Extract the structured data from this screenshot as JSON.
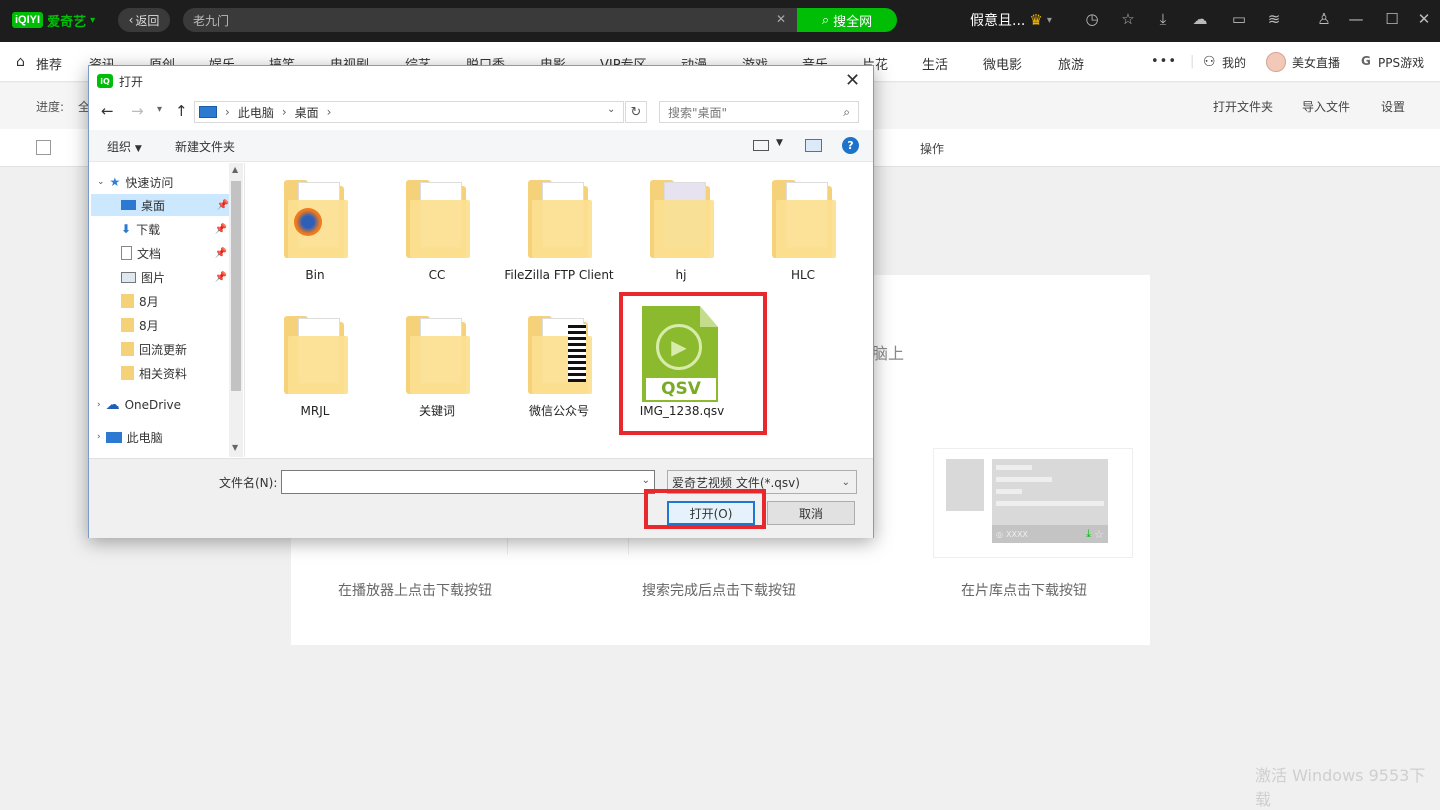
{
  "app": {
    "logo_box": "iQIYI",
    "logo_text": "爱奇艺",
    "back_label": "返回",
    "search_value": "老九门",
    "search_button": "搜全网",
    "user_name": "假意且..."
  },
  "nav": {
    "items": [
      "推荐",
      "资讯",
      "原创",
      "娱乐",
      "搞笑",
      "电视剧",
      "综艺",
      "脱口秀",
      "电影",
      "VIP专区",
      "动漫",
      "游戏",
      "音乐",
      "片花",
      "生活",
      "微电影",
      "旅游"
    ],
    "more": "•••",
    "right": [
      "我的",
      "美女直播",
      "PPS游戏"
    ]
  },
  "subbar": {
    "progress_label": "进度:",
    "progress_trunc": "全",
    "actions": [
      "打开文件夹",
      "导入文件",
      "设置"
    ]
  },
  "table_header": {
    "operation": "操作"
  },
  "card": {
    "steps": [
      "在播放器上点击下载按钮",
      "搜索完成后点击下载按钮",
      "在片库点击下载按钮"
    ],
    "partial_text": "脑上",
    "mock_text": "XXXX"
  },
  "dialog": {
    "title": "打开",
    "path": [
      "此电脑",
      "桌面"
    ],
    "search_placeholder": "搜索\"桌面\"",
    "organize": "组织",
    "new_folder": "新建文件夹",
    "tree": [
      {
        "label": "快速访问",
        "icon": "star-icon",
        "pin": false
      },
      {
        "label": "桌面",
        "icon": "desktop-icon",
        "pin": true,
        "selected": true
      },
      {
        "label": "下载",
        "icon": "download-icon",
        "pin": true
      },
      {
        "label": "文档",
        "icon": "document-icon",
        "pin": true
      },
      {
        "label": "图片",
        "icon": "picture-icon",
        "pin": true
      },
      {
        "label": "8月",
        "icon": "folder-icon",
        "pin": false
      },
      {
        "label": "8月",
        "icon": "folder-icon",
        "pin": false
      },
      {
        "label": "回流更新",
        "icon": "folder-icon",
        "pin": false
      },
      {
        "label": "相关资料",
        "icon": "folder-icon",
        "pin": false
      },
      {
        "label": "OneDrive",
        "icon": "cloud-icon",
        "pin": false
      },
      {
        "label": "此电脑",
        "icon": "computer-icon",
        "pin": false
      }
    ],
    "files": [
      "Bin",
      "CC",
      "FileZilla FTP Client",
      "hj",
      "HLC",
      "MRJL",
      "关键词",
      "微信公众号"
    ],
    "qsv_file": "IMG_1238.qsv",
    "qsv_badge": "QSV",
    "filename_label": "文件名(N):",
    "filename_value": "",
    "filetype": "爱奇艺视频 文件(*.qsv)",
    "open_button": "打开(O)",
    "cancel_button": "取消"
  },
  "watermark": "激活 Windows 9553下载",
  "colors": {
    "brand": "#00be06",
    "highlight": "#e8282c",
    "qsv_green": "#8cba2f",
    "selection": "#cce8ff"
  }
}
